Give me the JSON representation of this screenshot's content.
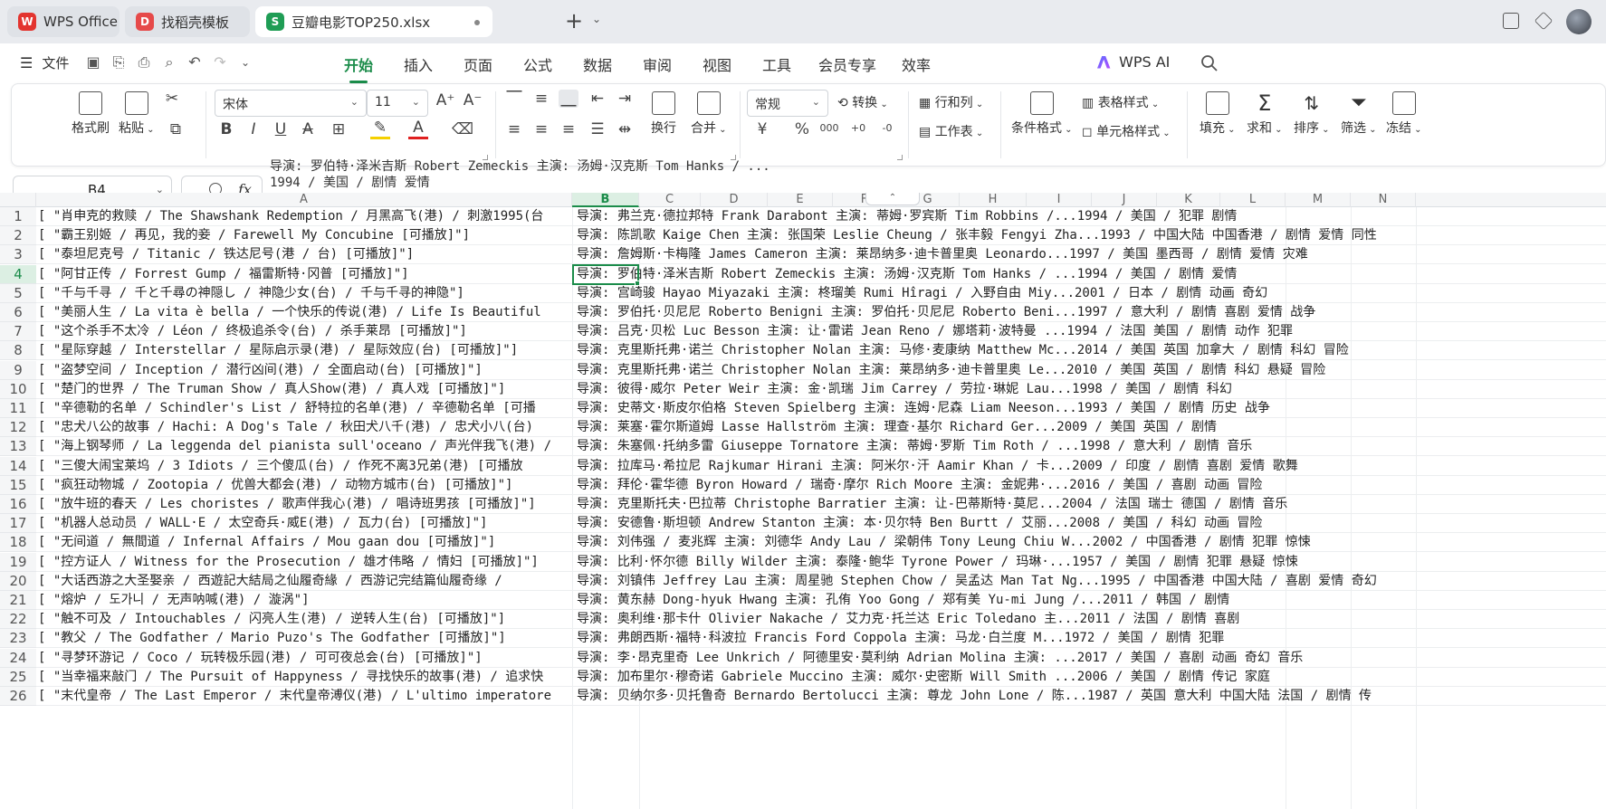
{
  "tabs": [
    {
      "label": "WPS Office",
      "logo": "W",
      "color": "#e3342f"
    },
    {
      "label": "找稻壳模板",
      "logo": "D",
      "color": "#e64a4a"
    },
    {
      "label": "豆瓣电影TOP250.xlsx",
      "logo": "S",
      "color": "#1f9d55"
    }
  ],
  "menu": {
    "file_label": "文件",
    "tabs": [
      "开始",
      "插入",
      "页面",
      "公式",
      "数据",
      "审阅",
      "视图",
      "工具",
      "会员专享",
      "效率"
    ],
    "ai_label": "WPS AI"
  },
  "ribbon": {
    "format_painter": "格式刷",
    "paste": "粘贴",
    "font_name": "宋体",
    "font_size": "11",
    "wrap": "换行",
    "merge": "合并",
    "number_format": "常规",
    "convert": "转换",
    "rows_cols": "行和列",
    "worksheet": "工作表",
    "cond_format": "条件格式",
    "table_style": "表格样式",
    "cell_style": "单元格样式",
    "fill": "填充",
    "sum": "求和",
    "sort": "排序",
    "filter": "筛选",
    "freeze": "冻结",
    "currency_symbol": "¥",
    "percent_symbol": "%",
    "thousands_symbol": "000",
    "colors": {
      "accent": "#1b8c4a",
      "font_color": "#e02020",
      "highlight": "#f5d000"
    }
  },
  "formula_bar": {
    "cell_ref": "B4",
    "fx": "fx",
    "line1": "导演: 罗伯特·泽米吉斯 Robert Zemeckis   主演: 汤姆·汉克斯 Tom Hanks / ...",
    "line2": "1994 / 美国 / 剧情 爱情"
  },
  "columns": [
    "A",
    "B",
    "C",
    "D",
    "E",
    "F",
    "G",
    "H",
    "I",
    "J",
    "K",
    "L",
    "M",
    "N"
  ],
  "selected_cell": {
    "col": "B",
    "row": 4
  },
  "rows": [
    {
      "n": "1",
      "a": "[ \"肖申克的救赎 / The Shawshank Redemption / 月黑高飞(港) / 刺激1995(台",
      "b": "导演: 弗兰克·德拉邦特 Frank Darabont   主演: 蒂姆·罗宾斯 Tim Robbins /...1994 / 美国 / 犯罪 剧情"
    },
    {
      "n": "2",
      "a": "[ \"霸王别姬 / 再见，我的妾 / Farewell My Concubine [可播放]\"]",
      "b": "导演: 陈凯歌 Kaige Chen   主演: 张国荣 Leslie Cheung / 张丰毅 Fengyi Zha...1993 / 中国大陆 中国香港 / 剧情 爱情 同性"
    },
    {
      "n": "3",
      "a": "[ \"泰坦尼克号 / Titanic / 铁达尼号(港 / 台) [可播放]\"]",
      "b": "导演: 詹姆斯·卡梅隆 James Cameron   主演: 莱昂纳多·迪卡普里奥 Leonardo...1997 / 美国 墨西哥 / 剧情 爱情 灾难"
    },
    {
      "n": "4",
      "a": "[ \"阿甘正传 / Forrest Gump / 福雷斯特·冈普 [可播放]\"]",
      "b": "导演: 罗伯特·泽米吉斯 Robert Zemeckis   主演: 汤姆·汉克斯 Tom Hanks / ...1994 / 美国 / 剧情 爱情"
    },
    {
      "n": "5",
      "a": "[ \"千与千寻 / 千と千尋の神隠し / 神隐少女(台) / 千与千寻的神隐\"]",
      "b": "导演: 宫崎骏 Hayao Miyazaki   主演: 柊瑠美 Rumi Hîragi / 入野自由 Miy...2001 / 日本 / 剧情 动画 奇幻"
    },
    {
      "n": "6",
      "a": "[ \"美丽人生 / La vita è bella / 一个快乐的传说(港) / Life Is Beautiful",
      "b": "导演: 罗伯托·贝尼尼 Roberto Benigni   主演: 罗伯托·贝尼尼 Roberto Beni...1997 / 意大利 / 剧情 喜剧 爱情 战争"
    },
    {
      "n": "7",
      "a": "[ \"这个杀手不太冷 / Léon / 终极追杀令(台) / 杀手莱昂 [可播放]\"]",
      "b": "导演: 吕克·贝松 Luc Besson   主演: 让·雷诺 Jean Reno / 娜塔莉·波特曼 ...1994 / 法国 美国 / 剧情 动作 犯罪"
    },
    {
      "n": "8",
      "a": "[ \"星际穿越 / Interstellar / 星际启示录(港) / 星际效应(台) [可播放]\"]",
      "b": "导演: 克里斯托弗·诺兰 Christopher Nolan   主演: 马修·麦康纳 Matthew Mc...2014 / 美国 英国 加拿大 / 剧情 科幻 冒险"
    },
    {
      "n": "9",
      "a": "[ \"盗梦空间 / Inception / 潜行凶间(港) / 全面启动(台) [可播放]\"]",
      "b": "导演: 克里斯托弗·诺兰 Christopher Nolan   主演: 莱昂纳多·迪卡普里奥 Le...2010 / 美国 英国 / 剧情 科幻 悬疑 冒险"
    },
    {
      "n": "10",
      "a": "[ \"楚门的世界 / The Truman Show / 真人Show(港) / 真人戏 [可播放]\"]",
      "b": "导演: 彼得·威尔 Peter Weir   主演: 金·凯瑞 Jim Carrey / 劳拉·琳妮 Lau...1998 / 美国 / 剧情 科幻"
    },
    {
      "n": "11",
      "a": "[ \"辛德勒的名单 / Schindler's List / 舒特拉的名单(港) / 辛德勒名单 [可播",
      "b": "导演: 史蒂文·斯皮尔伯格 Steven Spielberg   主演: 连姆·尼森 Liam Neeson...1993 / 美国 / 剧情 历史 战争"
    },
    {
      "n": "12",
      "a": "[ \"忠犬八公的故事 / Hachi: A Dog's Tale / 秋田犬八千(港) / 忠犬小八(台) ",
      "b": "导演: 莱塞·霍尔斯道姆 Lasse Hallström   主演: 理查·基尔 Richard Ger...2009 / 美国 英国 / 剧情"
    },
    {
      "n": "13",
      "a": "[ \"海上钢琴师 / La leggenda del pianista sull'oceano / 声光伴我飞(港) / ",
      "b": "导演: 朱塞佩·托纳多雷 Giuseppe Tornatore   主演: 蒂姆·罗斯 Tim Roth / ...1998 / 意大利 / 剧情 音乐"
    },
    {
      "n": "14",
      "a": "[ \"三傻大闹宝莱坞 / 3 Idiots / 三个傻瓜(台) / 作死不离3兄弟(港) [可播放",
      "b": "导演: 拉库马·希拉尼 Rajkumar Hirani   主演: 阿米尔·汗 Aamir Khan / 卡...2009 / 印度 / 剧情 喜剧 爱情 歌舞"
    },
    {
      "n": "15",
      "a": "[ \"疯狂动物城 / Zootopia / 优兽大都会(港) / 动物方城市(台) [可播放]\"]",
      "b": "导演: 拜伦·霍华德 Byron Howard / 瑞奇·摩尔 Rich Moore   主演: 金妮弗·...2016 / 美国 / 喜剧 动画 冒险"
    },
    {
      "n": "16",
      "a": "[ \"放牛班的春天 / Les choristes / 歌声伴我心(港) / 唱诗班男孩 [可播放]\"]",
      "b": "导演: 克里斯托夫·巴拉蒂 Christophe Barratier   主演: 让-巴蒂斯特·莫尼...2004 / 法国 瑞士 德国 / 剧情 音乐"
    },
    {
      "n": "17",
      "a": "[ \"机器人总动员 / WALL·E / 太空奇兵·威E(港) / 瓦力(台) [可播放]\"]",
      "b": "导演: 安德鲁·斯坦顿 Andrew Stanton   主演: 本·贝尔特 Ben Burtt / 艾丽...2008 / 美国 / 科幻 动画 冒险"
    },
    {
      "n": "18",
      "a": "[ \"无间道 / 無間道 / Infernal Affairs / Mou gaan dou [可播放]\"]",
      "b": "导演: 刘伟强 / 麦兆辉   主演: 刘德华 Andy Lau / 梁朝伟 Tony Leung Chiu W...2002 / 中国香港 / 剧情 犯罪 惊悚"
    },
    {
      "n": "19",
      "a": "[ \"控方证人 / Witness for the Prosecution / 雄才伟略 / 情妇 [可播放]\"]",
      "b": "导演: 比利·怀尔德 Billy Wilder   主演: 泰隆·鲍华 Tyrone Power / 玛琳·...1957 / 美国 / 剧情 犯罪 悬疑 惊悚"
    },
    {
      "n": "20",
      "a": "[ \"大话西游之大圣娶亲 / 西遊記大結局之仙履奇緣 / 西游记完结篇仙履奇缘 / ",
      "b": "导演: 刘镇伟 Jeffrey Lau   主演: 周星驰 Stephen Chow / 吴孟达 Man Tat Ng...1995 / 中国香港 中国大陆 / 喜剧 爱情 奇幻"
    },
    {
      "n": "21",
      "a": "[ \"熔炉 / 도가니 / 无声呐喊(港) / 漩涡\"]",
      "b": "导演: 黄东赫 Dong-hyuk Hwang   主演: 孔侑 Yoo Gong / 郑有美 Yu-mi Jung /...2011 / 韩国 / 剧情"
    },
    {
      "n": "22",
      "a": "[ \"触不可及 / Intouchables / 闪亮人生(港) / 逆转人生(台) [可播放]\"]",
      "b": "导演: 奥利维·那卡什 Olivier Nakache / 艾力克·托兰达 Eric Toledano   主...2011 / 法国 / 剧情 喜剧"
    },
    {
      "n": "23",
      "a": "[ \"教父 / The Godfather / Mario Puzo's The Godfather [可播放]\"]",
      "b": "导演: 弗朗西斯·福特·科波拉 Francis Ford Coppola   主演: 马龙·白兰度 M...1972 / 美国 / 剧情 犯罪"
    },
    {
      "n": "24",
      "a": "[ \"寻梦环游记 / Coco / 玩转极乐园(港) / 可可夜总会(台) [可播放]\"]",
      "b": "导演: 李·昂克里奇 Lee Unkrich / 阿德里安·莫利纳 Adrian Molina   主演: ...2017 / 美国 / 喜剧 动画 奇幻 音乐"
    },
    {
      "n": "25",
      "a": "[ \"当幸福来敲门 / The Pursuit of Happyness / 寻找快乐的故事(港) / 追求快",
      "b": "导演: 加布里尔·穆奇诺 Gabriele Muccino   主演: 威尔·史密斯 Will Smith ...2006 / 美国 / 剧情 传记 家庭"
    },
    {
      "n": "26",
      "a": "[ \"末代皇帝 / The Last Emperor / 末代皇帝溥仪(港) / L'ultimo imperatore",
      "b": "导演: 贝纳尔多·贝托鲁奇 Bernardo Bertolucci   主演: 尊龙 John Lone / 陈...1987 / 英国 意大利 中国大陆 法国 / 剧情 传"
    }
  ]
}
